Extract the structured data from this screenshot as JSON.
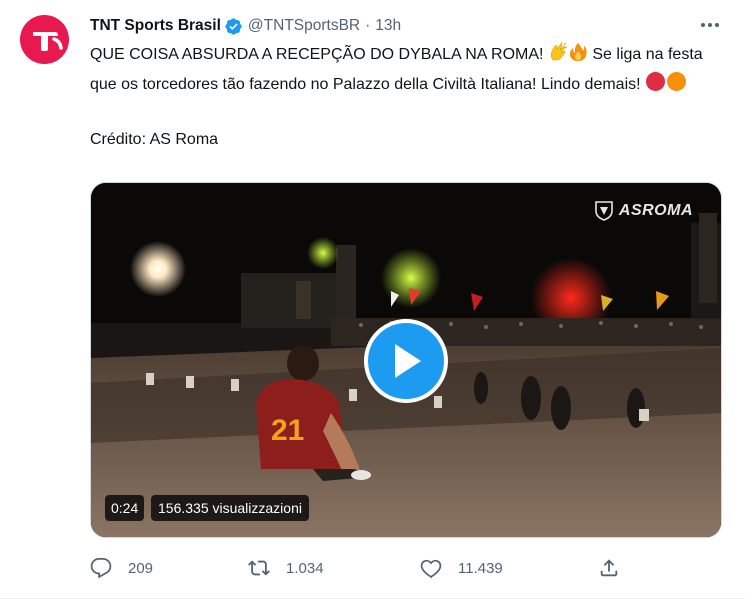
{
  "tweet": {
    "display_name": "TNT Sports Brasil",
    "handle": "@TNTSportsBR",
    "separator": "·",
    "time": "13h",
    "verified_icon": "verified-badge-icon",
    "text_line1": "QUE COISA ABSURDA A RECEPÇÃO DO DYBALA NA ROMA! ",
    "text_line1_tail": " Se liga na festa que os torcedores tão fazendo no Palazzo della Civiltà Italiana! Lindo demais! ",
    "credit": "Crédito: AS Roma",
    "emojis": [
      "clapping-hands-icon",
      "fire-icon",
      "red-circle-icon",
      "orange-circle-icon"
    ]
  },
  "media": {
    "duration": "0:24",
    "views": "156.335 visualizzazioni",
    "watermark": "ASROMA",
    "play_icon": "play-icon"
  },
  "actions": {
    "reply_count": "209",
    "retweet_count": "1.034",
    "like_count": "11.439"
  },
  "colors": {
    "accent": "#1d9bf0",
    "avatar_bg": "#e8194f",
    "muted_text": "#536471"
  }
}
